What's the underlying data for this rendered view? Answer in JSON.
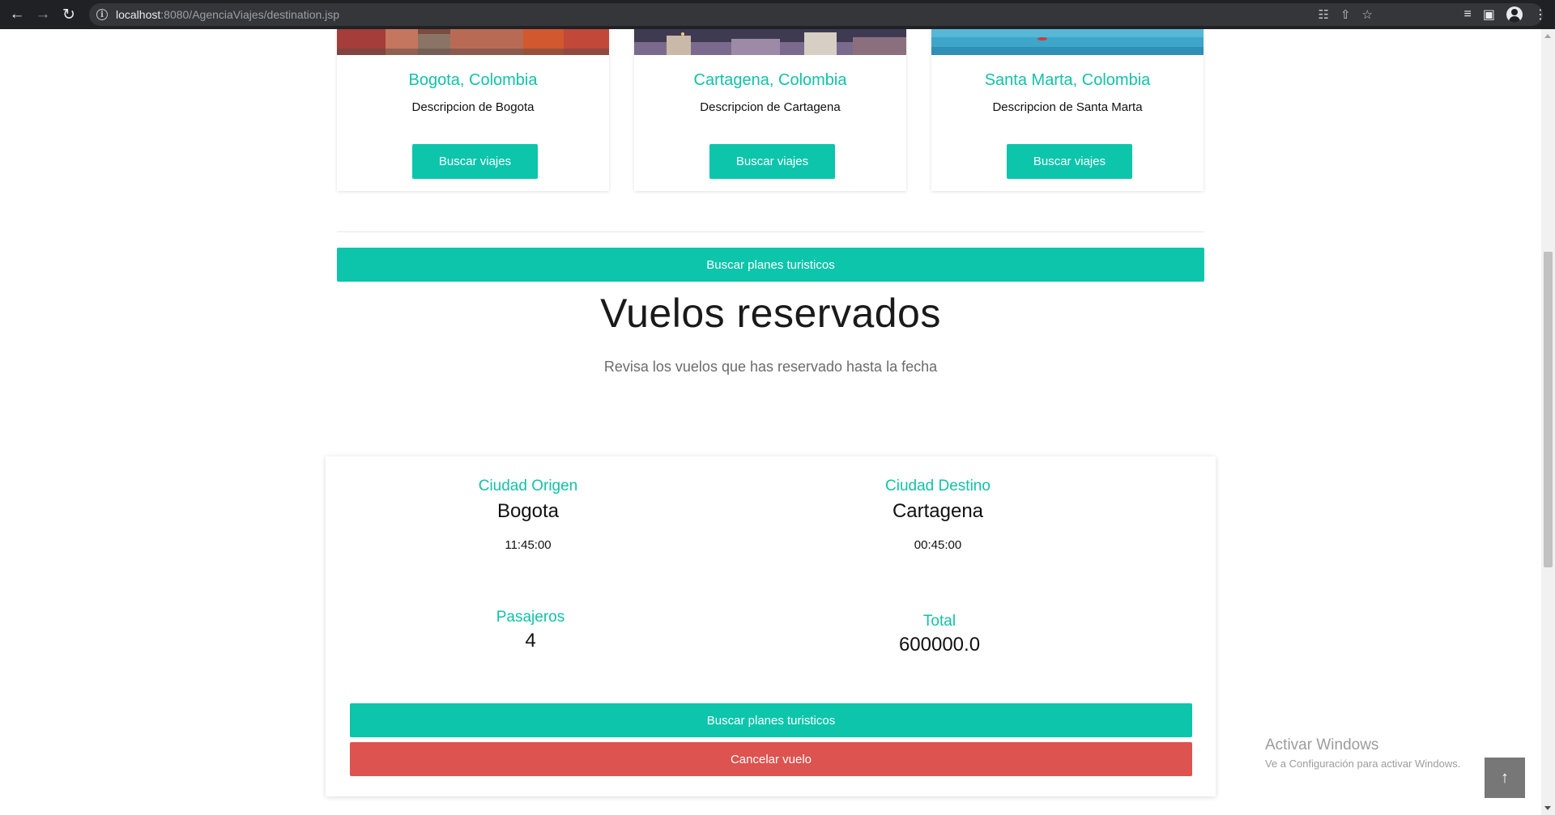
{
  "browser": {
    "url_host": "localhost",
    "url_rest": ":8080/AgenciaViajes/destination.jsp",
    "icons": {
      "back": "arrow-left-icon",
      "forward": "arrow-right-icon",
      "reload": "reload-icon",
      "info": "info-icon",
      "translate": "translate-icon",
      "share": "share-icon",
      "bookmark": "star-icon",
      "media": "media-queue-icon",
      "sidepanel": "side-panel-icon",
      "profile": "avatar-icon",
      "menu": "kebab-menu-icon"
    }
  },
  "destinations": [
    {
      "title": "Bogota, Colombia",
      "description": "Descripcion de Bogota",
      "button": "Buscar viajes"
    },
    {
      "title": "Cartagena, Colombia",
      "description": "Descripcion de Cartagena",
      "button": "Buscar viajes"
    },
    {
      "title": "Santa Marta, Colombia",
      "description": "Descripcion de Santa Marta",
      "button": "Buscar viajes"
    }
  ],
  "plans_button": "Buscar planes turisticos",
  "section": {
    "title": "Vuelos reservados",
    "subtitle": "Revisa los vuelos que has reservado hasta la fecha"
  },
  "flight": {
    "origin_label": "Ciudad Origen",
    "origin_city": "Bogota",
    "origin_time": "11:45:00",
    "destination_label": "Ciudad Destino",
    "destination_city": "Cartagena",
    "destination_time": "00:45:00",
    "passengers_label": "Pasajeros",
    "passengers": "4",
    "total_label": "Total",
    "total": "600000.0",
    "plans_button": "Buscar planes turisticos",
    "cancel_button": "Cancelar vuelo"
  },
  "watermark": {
    "line1": "Activar Windows",
    "line2": "Ve a Configuración para activar Windows."
  },
  "colors": {
    "accent": "#0cc5ab",
    "danger": "#dc534f"
  }
}
